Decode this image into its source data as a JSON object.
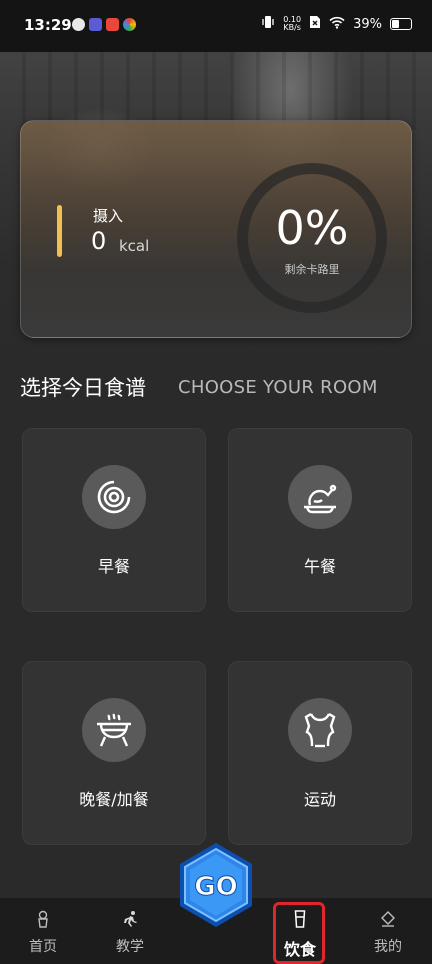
{
  "status_bar": {
    "time": "13:29",
    "net_speed_value": "0.10",
    "net_speed_unit": "KB/s",
    "battery": "39%"
  },
  "intake": {
    "label": "摄入",
    "value": "0",
    "unit": "kcal",
    "accent_color": "#f2c04c",
    "remaining_percent": "0%",
    "remaining_label": "剩余卡路里"
  },
  "section": {
    "title": "选择今日食谱",
    "subtitle": "CHOOSE YOUR ROOM"
  },
  "tiles": [
    {
      "label": "早餐",
      "icon": "breakfast-donut-icon"
    },
    {
      "label": "午餐",
      "icon": "lunch-chicken-icon"
    },
    {
      "label": "晚餐/加餐",
      "icon": "dinner-grill-icon"
    },
    {
      "label": "运动",
      "icon": "exercise-shirt-icon"
    }
  ],
  "go_button": {
    "label": "GO"
  },
  "nav": {
    "items": [
      {
        "label": "首页",
        "icon": "home-icon"
      },
      {
        "label": "教学",
        "icon": "running-icon"
      },
      {
        "label": "饮食",
        "icon": "cup-icon",
        "active": true
      },
      {
        "label": "我的",
        "icon": "profile-icon"
      }
    ],
    "highlight_color": "#e0262b"
  }
}
